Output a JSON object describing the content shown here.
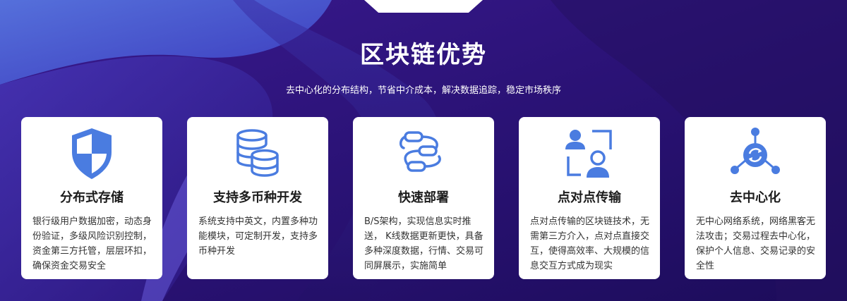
{
  "section": {
    "title": "区块链优势",
    "subtitle": "去中心化的分布结构，节省中介成本，解决数据追踪，稳定市场秩序"
  },
  "colors": {
    "background_dark": "#2a0f6e",
    "background_accent": "#4f6fe0",
    "icon_blue": "#4a7ce0",
    "card_background": "#ffffff"
  },
  "cards": [
    {
      "icon": "shield-icon",
      "title": "分布式存储",
      "description": "银行级用户数据加密，动态身份验证，多级风险识别控制，资金第三方托管，层层环扣，确保资金交易安全"
    },
    {
      "icon": "coin-stack-icon",
      "title": "支持多币种开发",
      "description": "系统支持中英文，内置多种功能模块，可定制开发，支持多币种开发"
    },
    {
      "icon": "flowchart-icon",
      "title": "快速部署",
      "description": "B/S架构，实现信息实时推送， K线数据更新更快，具备多种深度数据，行情、交易可同屏展示，实施简单"
    },
    {
      "icon": "peer-to-peer-icon",
      "title": "点对点传输",
      "description": "点对点传输的区块链技术，无需第三方介入，点对点直接交互，使得高效率、大规模的信息交互方式成为现实"
    },
    {
      "icon": "decentralized-network-icon",
      "title": "去中心化",
      "description": "无中心网络系统，网络黑客无法攻击；交易过程去中心化，保护个人信息、交易记录的安全性"
    }
  ]
}
